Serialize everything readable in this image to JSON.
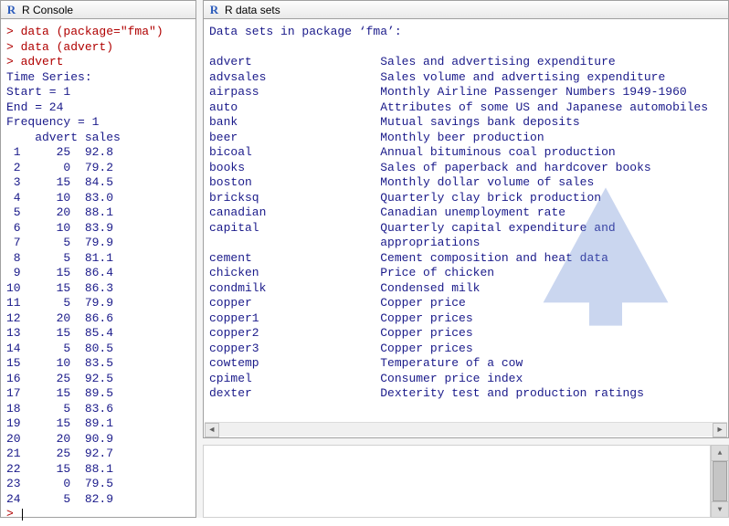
{
  "console": {
    "title": "R Console",
    "commands": [
      "data (package=\"fma\")",
      "data (advert)",
      "advert"
    ],
    "ts_header": [
      "Time Series:",
      "Start = 1",
      "End = 24",
      "Frequency = 1"
    ],
    "table": {
      "cols": [
        "advert",
        "sales"
      ],
      "rows": [
        [
          1,
          25,
          92.8
        ],
        [
          2,
          0,
          79.2
        ],
        [
          3,
          15,
          84.5
        ],
        [
          4,
          10,
          83.0
        ],
        [
          5,
          20,
          88.1
        ],
        [
          6,
          10,
          83.9
        ],
        [
          7,
          5,
          79.9
        ],
        [
          8,
          5,
          81.1
        ],
        [
          9,
          15,
          86.4
        ],
        [
          10,
          15,
          86.3
        ],
        [
          11,
          5,
          79.9
        ],
        [
          12,
          20,
          86.6
        ],
        [
          13,
          15,
          85.4
        ],
        [
          14,
          5,
          80.5
        ],
        [
          15,
          10,
          83.5
        ],
        [
          16,
          25,
          92.5
        ],
        [
          17,
          15,
          89.5
        ],
        [
          18,
          5,
          83.6
        ],
        [
          19,
          15,
          89.1
        ],
        [
          20,
          20,
          90.9
        ],
        [
          21,
          25,
          92.7
        ],
        [
          22,
          15,
          88.1
        ],
        [
          23,
          0,
          79.5
        ],
        [
          24,
          5,
          82.9
        ]
      ]
    },
    "prompt": ">"
  },
  "datasets": {
    "title": "R data sets",
    "header": "Data sets in package ‘fma’:",
    "items": [
      {
        "name": "advert",
        "desc": "Sales and advertising expenditure"
      },
      {
        "name": "advsales",
        "desc": "Sales volume and advertising expenditure"
      },
      {
        "name": "airpass",
        "desc": "Monthly Airline Passenger Numbers 1949-1960"
      },
      {
        "name": "auto",
        "desc": "Attributes of some US and Japanese automobiles"
      },
      {
        "name": "bank",
        "desc": "Mutual savings bank deposits"
      },
      {
        "name": "beer",
        "desc": "Monthly beer production"
      },
      {
        "name": "bicoal",
        "desc": "Annual bituminous coal production"
      },
      {
        "name": "books",
        "desc": "Sales of paperback and hardcover books"
      },
      {
        "name": "boston",
        "desc": "Monthly dollar volume of sales"
      },
      {
        "name": "bricksq",
        "desc": "Quarterly clay brick production"
      },
      {
        "name": "canadian",
        "desc": "Canadian unemployment rate"
      },
      {
        "name": "capital",
        "desc": "Quarterly capital expenditure and appropriations"
      },
      {
        "name": "cement",
        "desc": "Cement composition and heat data"
      },
      {
        "name": "chicken",
        "desc": "Price of chicken"
      },
      {
        "name": "condmilk",
        "desc": "Condensed milk"
      },
      {
        "name": "copper",
        "desc": "Copper price"
      },
      {
        "name": "copper1",
        "desc": "Copper prices"
      },
      {
        "name": "copper2",
        "desc": "Copper prices"
      },
      {
        "name": "copper3",
        "desc": "Copper prices"
      },
      {
        "name": "cowtemp",
        "desc": "Temperature of a cow"
      },
      {
        "name": "cpimel",
        "desc": "Consumer price index"
      },
      {
        "name": "dexter",
        "desc": "Dexterity test and production ratings"
      }
    ]
  }
}
